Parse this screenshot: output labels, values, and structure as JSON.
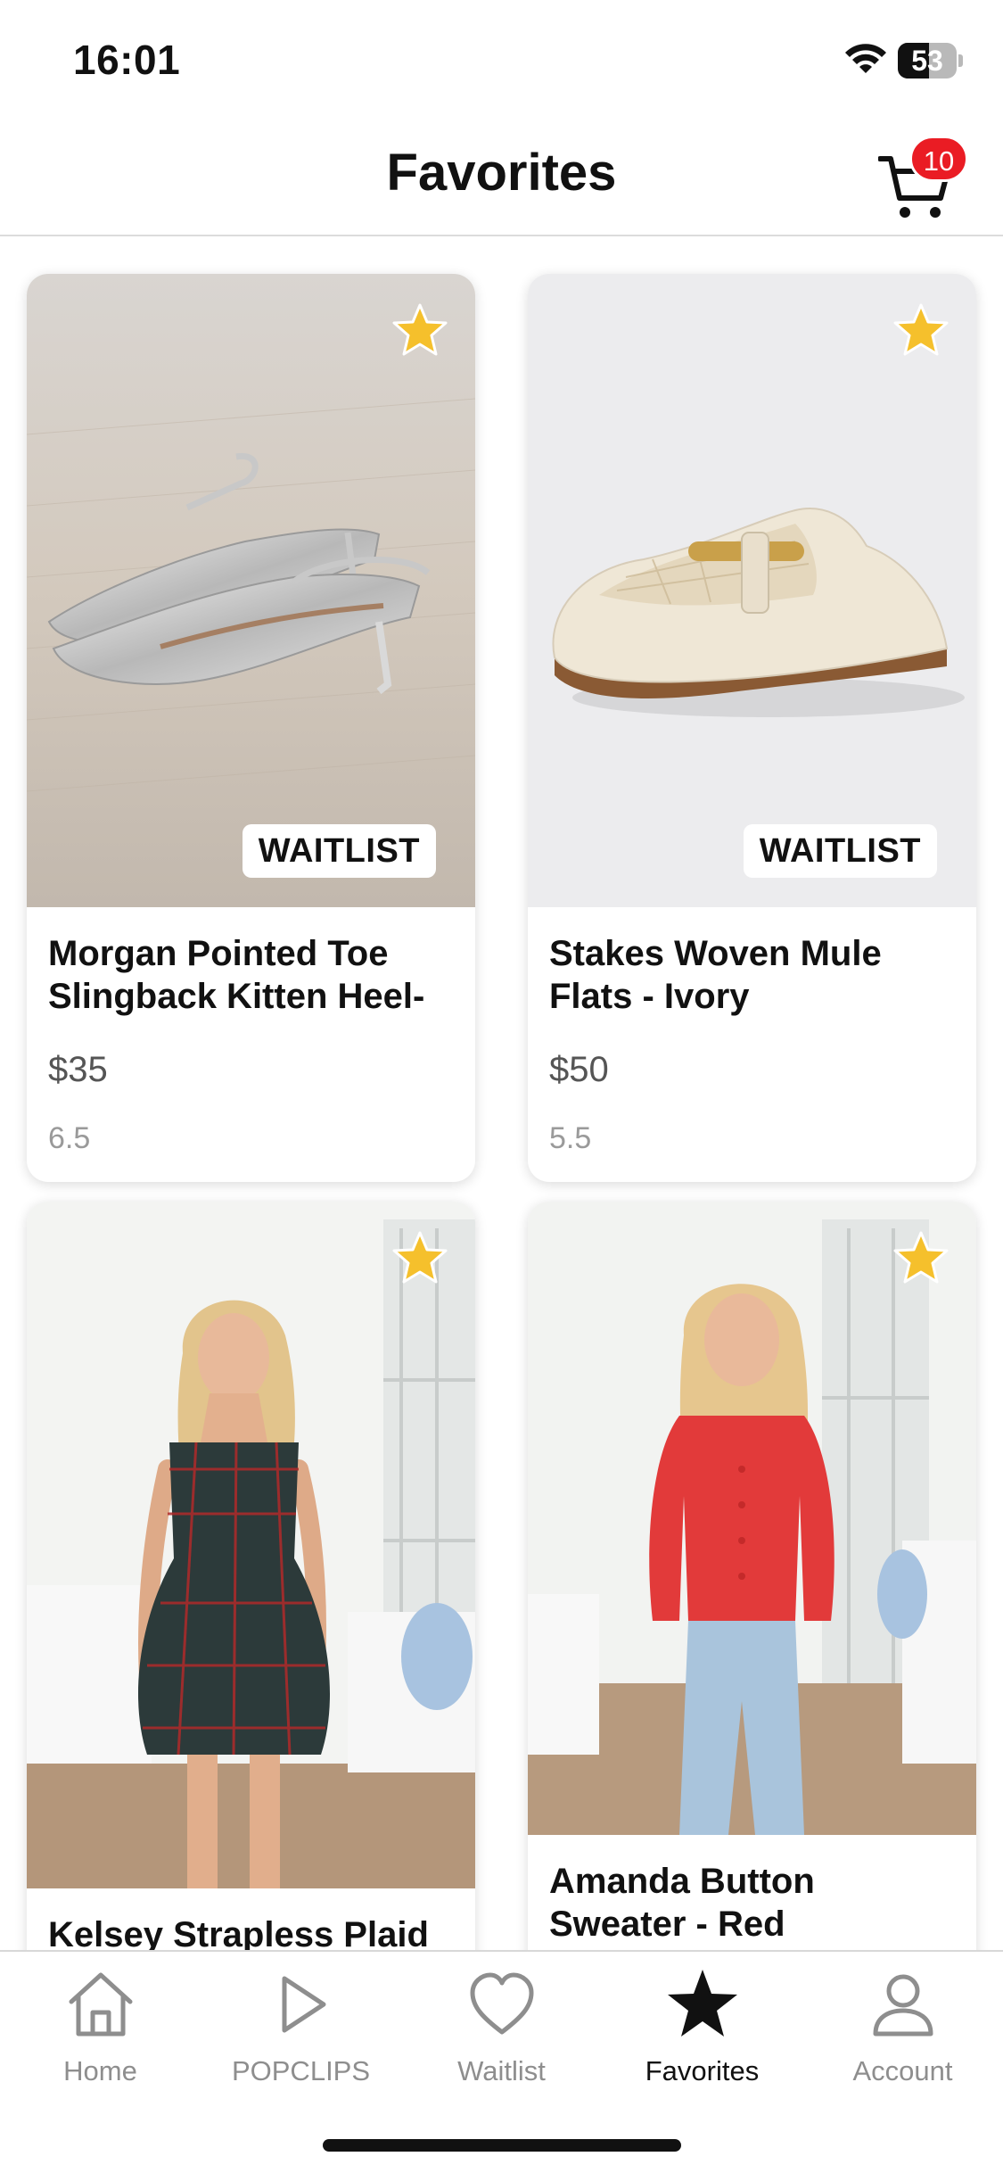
{
  "status_bar": {
    "time": "16:01",
    "battery": "53",
    "battery_level": 0.53
  },
  "header": {
    "title": "Favorites",
    "cart_count": "10"
  },
  "products": [
    {
      "name": "Morgan Pointed Toe Slingback Kitten Heel-",
      "price": "$35",
      "size": "6.5",
      "badge": "WAITLIST",
      "favorited": true,
      "image": "silver-kitten-heel-photo"
    },
    {
      "name": "Stakes Woven Mule Flats - Ivory",
      "price": "$50",
      "size": "5.5",
      "badge": "WAITLIST",
      "favorited": true,
      "image": "ivory-woven-mule-photo"
    },
    {
      "name": "Kelsey Strapless Plaid",
      "price": "",
      "size": "",
      "badge": "",
      "favorited": true,
      "image": "plaid-dress-model-photo"
    },
    {
      "name": "Amanda Button Sweater - Red",
      "price": "",
      "size": "",
      "badge": "",
      "favorited": true,
      "image": "red-sweater-model-photo"
    }
  ],
  "tab_bar": {
    "active": "Favorites",
    "tabs": [
      {
        "label": "Home",
        "icon": "house-icon"
      },
      {
        "label": "POPCLIPS",
        "icon": "play-icon"
      },
      {
        "label": "Waitlist",
        "icon": "heart-icon"
      },
      {
        "label": "Favorites",
        "icon": "star-icon"
      },
      {
        "label": "Account",
        "icon": "person-icon"
      }
    ]
  },
  "colors": {
    "accent_star": "#f5c02c",
    "badge_red": "#ea1c24",
    "text_primary": "#111111",
    "text_muted": "#8e8e8e"
  }
}
